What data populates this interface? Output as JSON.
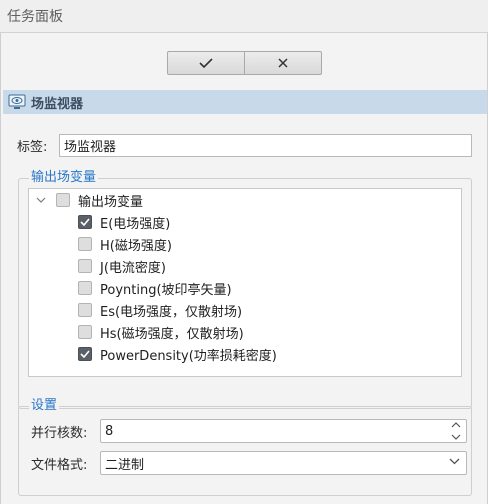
{
  "window": {
    "title": "任务面板"
  },
  "toolbar": {
    "confirm_icon": "check-icon",
    "cancel_icon": "close-icon"
  },
  "section": {
    "title": "场监视器",
    "icon": "eye-monitor-icon",
    "header_color": "#c8d9e9"
  },
  "label_field": {
    "label": "标签:",
    "value": "场监视器"
  },
  "output_vars": {
    "legend": "输出场变量",
    "root_label": "输出场变量",
    "items": [
      {
        "label": "E(电场强度)",
        "checked": true
      },
      {
        "label": "H(磁场强度)",
        "checked": false
      },
      {
        "label": "J(电流密度)",
        "checked": false
      },
      {
        "label": "Poynting(坡印亭矢量)",
        "checked": false
      },
      {
        "label": "Es(电场强度，仅散射场)",
        "checked": false
      },
      {
        "label": "Hs(磁场强度，仅散射场)",
        "checked": false
      },
      {
        "label": "PowerDensity(功率损耗密度)",
        "checked": true
      }
    ]
  },
  "settings": {
    "legend": "设置",
    "threads_label": "并行核数:",
    "threads_value": "8",
    "format_label": "文件格式:",
    "format_value": "二进制"
  },
  "colors": {
    "legend_blue": "#2a77c9",
    "checkbox_checked": "#5a6068"
  }
}
